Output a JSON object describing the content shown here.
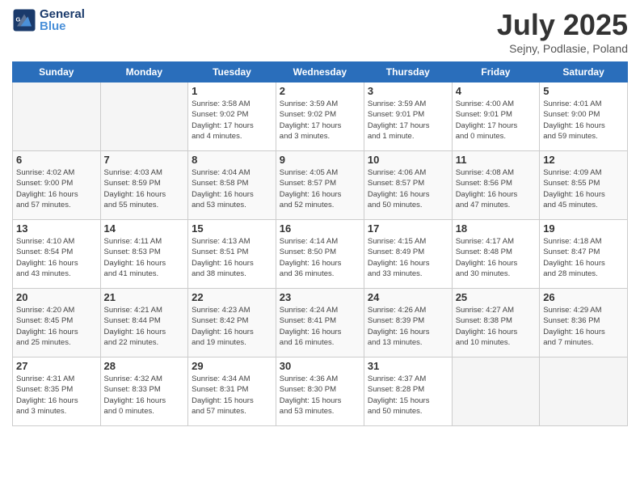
{
  "header": {
    "logo_general": "General",
    "logo_blue": "Blue",
    "month_title": "July 2025",
    "location": "Sejny, Podlasie, Poland"
  },
  "weekdays": [
    "Sunday",
    "Monday",
    "Tuesday",
    "Wednesday",
    "Thursday",
    "Friday",
    "Saturday"
  ],
  "weeks": [
    [
      {
        "day": "",
        "detail": ""
      },
      {
        "day": "",
        "detail": ""
      },
      {
        "day": "1",
        "detail": "Sunrise: 3:58 AM\nSunset: 9:02 PM\nDaylight: 17 hours\nand 4 minutes."
      },
      {
        "day": "2",
        "detail": "Sunrise: 3:59 AM\nSunset: 9:02 PM\nDaylight: 17 hours\nand 3 minutes."
      },
      {
        "day": "3",
        "detail": "Sunrise: 3:59 AM\nSunset: 9:01 PM\nDaylight: 17 hours\nand 1 minute."
      },
      {
        "day": "4",
        "detail": "Sunrise: 4:00 AM\nSunset: 9:01 PM\nDaylight: 17 hours\nand 0 minutes."
      },
      {
        "day": "5",
        "detail": "Sunrise: 4:01 AM\nSunset: 9:00 PM\nDaylight: 16 hours\nand 59 minutes."
      }
    ],
    [
      {
        "day": "6",
        "detail": "Sunrise: 4:02 AM\nSunset: 9:00 PM\nDaylight: 16 hours\nand 57 minutes."
      },
      {
        "day": "7",
        "detail": "Sunrise: 4:03 AM\nSunset: 8:59 PM\nDaylight: 16 hours\nand 55 minutes."
      },
      {
        "day": "8",
        "detail": "Sunrise: 4:04 AM\nSunset: 8:58 PM\nDaylight: 16 hours\nand 53 minutes."
      },
      {
        "day": "9",
        "detail": "Sunrise: 4:05 AM\nSunset: 8:57 PM\nDaylight: 16 hours\nand 52 minutes."
      },
      {
        "day": "10",
        "detail": "Sunrise: 4:06 AM\nSunset: 8:57 PM\nDaylight: 16 hours\nand 50 minutes."
      },
      {
        "day": "11",
        "detail": "Sunrise: 4:08 AM\nSunset: 8:56 PM\nDaylight: 16 hours\nand 47 minutes."
      },
      {
        "day": "12",
        "detail": "Sunrise: 4:09 AM\nSunset: 8:55 PM\nDaylight: 16 hours\nand 45 minutes."
      }
    ],
    [
      {
        "day": "13",
        "detail": "Sunrise: 4:10 AM\nSunset: 8:54 PM\nDaylight: 16 hours\nand 43 minutes."
      },
      {
        "day": "14",
        "detail": "Sunrise: 4:11 AM\nSunset: 8:53 PM\nDaylight: 16 hours\nand 41 minutes."
      },
      {
        "day": "15",
        "detail": "Sunrise: 4:13 AM\nSunset: 8:51 PM\nDaylight: 16 hours\nand 38 minutes."
      },
      {
        "day": "16",
        "detail": "Sunrise: 4:14 AM\nSunset: 8:50 PM\nDaylight: 16 hours\nand 36 minutes."
      },
      {
        "day": "17",
        "detail": "Sunrise: 4:15 AM\nSunset: 8:49 PM\nDaylight: 16 hours\nand 33 minutes."
      },
      {
        "day": "18",
        "detail": "Sunrise: 4:17 AM\nSunset: 8:48 PM\nDaylight: 16 hours\nand 30 minutes."
      },
      {
        "day": "19",
        "detail": "Sunrise: 4:18 AM\nSunset: 8:47 PM\nDaylight: 16 hours\nand 28 minutes."
      }
    ],
    [
      {
        "day": "20",
        "detail": "Sunrise: 4:20 AM\nSunset: 8:45 PM\nDaylight: 16 hours\nand 25 minutes."
      },
      {
        "day": "21",
        "detail": "Sunrise: 4:21 AM\nSunset: 8:44 PM\nDaylight: 16 hours\nand 22 minutes."
      },
      {
        "day": "22",
        "detail": "Sunrise: 4:23 AM\nSunset: 8:42 PM\nDaylight: 16 hours\nand 19 minutes."
      },
      {
        "day": "23",
        "detail": "Sunrise: 4:24 AM\nSunset: 8:41 PM\nDaylight: 16 hours\nand 16 minutes."
      },
      {
        "day": "24",
        "detail": "Sunrise: 4:26 AM\nSunset: 8:39 PM\nDaylight: 16 hours\nand 13 minutes."
      },
      {
        "day": "25",
        "detail": "Sunrise: 4:27 AM\nSunset: 8:38 PM\nDaylight: 16 hours\nand 10 minutes."
      },
      {
        "day": "26",
        "detail": "Sunrise: 4:29 AM\nSunset: 8:36 PM\nDaylight: 16 hours\nand 7 minutes."
      }
    ],
    [
      {
        "day": "27",
        "detail": "Sunrise: 4:31 AM\nSunset: 8:35 PM\nDaylight: 16 hours\nand 3 minutes."
      },
      {
        "day": "28",
        "detail": "Sunrise: 4:32 AM\nSunset: 8:33 PM\nDaylight: 16 hours\nand 0 minutes."
      },
      {
        "day": "29",
        "detail": "Sunrise: 4:34 AM\nSunset: 8:31 PM\nDaylight: 15 hours\nand 57 minutes."
      },
      {
        "day": "30",
        "detail": "Sunrise: 4:36 AM\nSunset: 8:30 PM\nDaylight: 15 hours\nand 53 minutes."
      },
      {
        "day": "31",
        "detail": "Sunrise: 4:37 AM\nSunset: 8:28 PM\nDaylight: 15 hours\nand 50 minutes."
      },
      {
        "day": "",
        "detail": ""
      },
      {
        "day": "",
        "detail": ""
      }
    ]
  ]
}
